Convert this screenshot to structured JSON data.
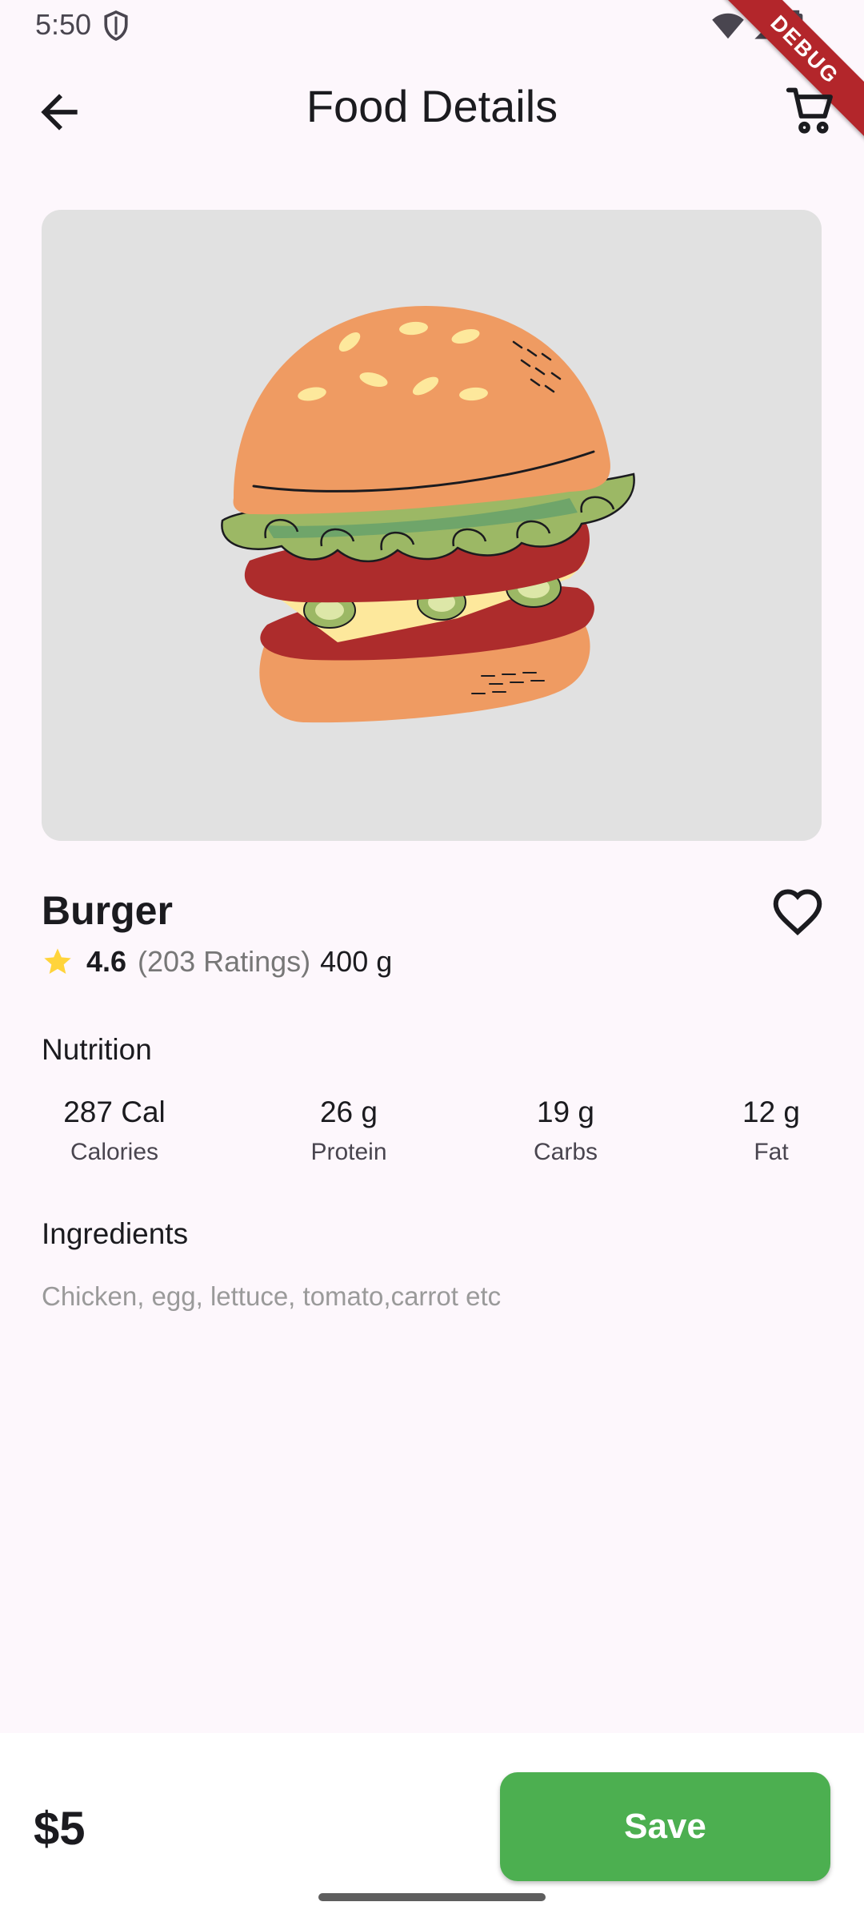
{
  "status_bar": {
    "time": "5:50",
    "icons": [
      "shield-icon",
      "wifi-icon",
      "signal-icon",
      "battery-icon"
    ]
  },
  "debug_banner": "DEBUG",
  "app_bar": {
    "title": "Food Details",
    "back_icon": "arrow-back-icon",
    "cart_icon": "shopping-cart-icon"
  },
  "food": {
    "name": "Burger",
    "rating": "4.6",
    "rating_count": "(203 Ratings)",
    "weight": "400 g",
    "favorite_icon": "heart-outline-icon",
    "star_color": "#FFD43B"
  },
  "nutrition": {
    "label": "Nutrition",
    "items": [
      {
        "value": "287 Cal",
        "label": "Calories"
      },
      {
        "value": "26 g",
        "label": "Protein"
      },
      {
        "value": "19 g",
        "label": "Carbs"
      },
      {
        "value": "12 g",
        "label": "Fat"
      }
    ]
  },
  "ingredients": {
    "label": "Ingredients",
    "text": "Chicken, egg, lettuce, tomato,carrot etc"
  },
  "bottom": {
    "price": "$5",
    "save_label": "Save",
    "accent": "#4CAF50"
  }
}
